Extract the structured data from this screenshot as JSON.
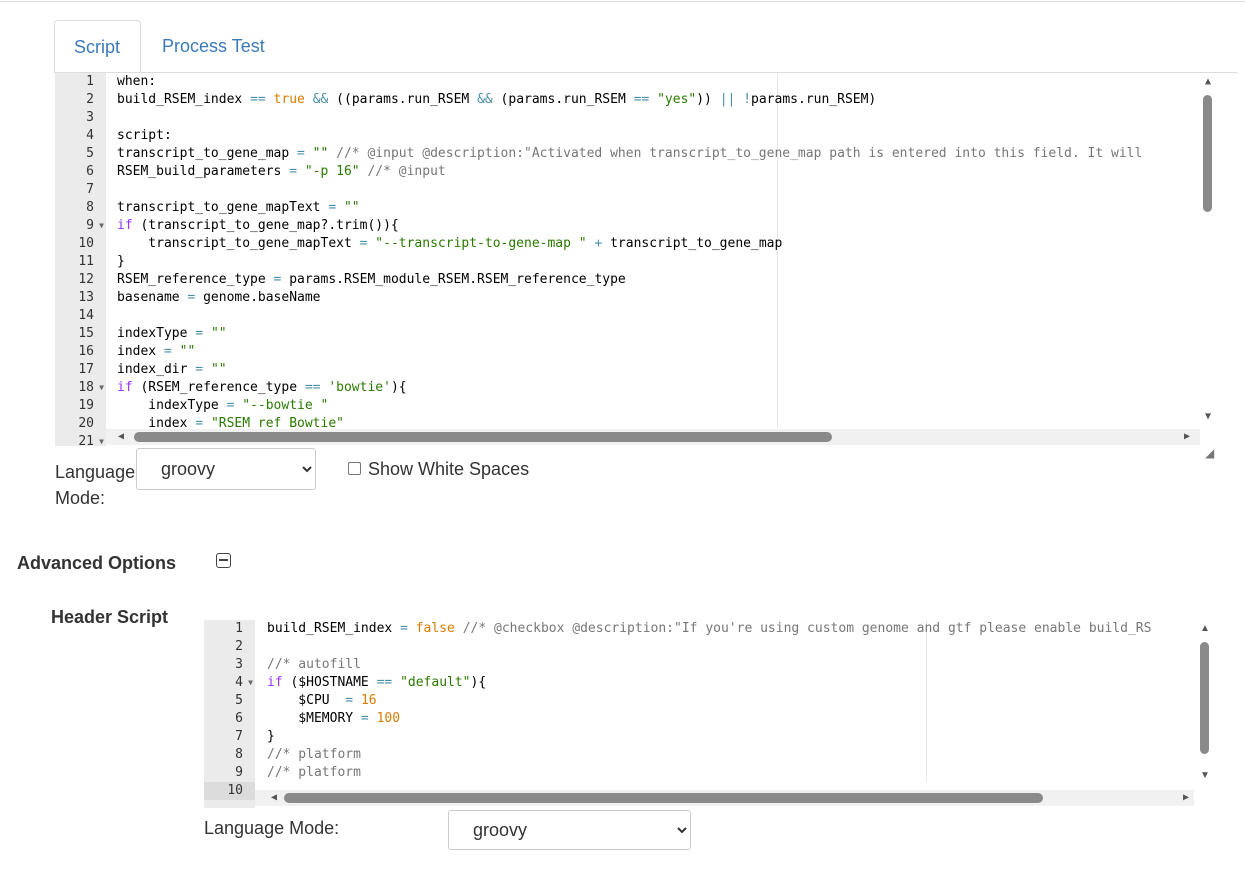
{
  "tabs": [
    {
      "label": "Script",
      "active": true
    },
    {
      "label": "Process Test",
      "active": false
    }
  ],
  "script_editor": {
    "lines": [
      {
        "n": "1",
        "fold": false,
        "code": [
          [
            "",
            "when:"
          ]
        ]
      },
      {
        "n": "2",
        "fold": false,
        "code": [
          [
            "",
            "build_RSEM_index "
          ],
          [
            "o",
            "=="
          ],
          [
            "",
            " "
          ],
          [
            "n",
            "true"
          ],
          [
            "",
            " "
          ],
          [
            "o",
            "&&"
          ],
          [
            "",
            " ((params.run_RSEM "
          ],
          [
            "o",
            "&&"
          ],
          [
            "",
            " (params.run_RSEM "
          ],
          [
            "o",
            "=="
          ],
          [
            "",
            " "
          ],
          [
            "s",
            "\"yes\""
          ],
          [
            "",
            "))"
          ],
          [
            "",
            " "
          ],
          [
            "o",
            "||"
          ],
          [
            "",
            " "
          ],
          [
            "o",
            "!"
          ],
          [
            "",
            "params.run_RSEM)"
          ]
        ]
      },
      {
        "n": "3",
        "fold": false,
        "code": []
      },
      {
        "n": "4",
        "fold": false,
        "code": [
          [
            "",
            "script:"
          ]
        ]
      },
      {
        "n": "5",
        "fold": false,
        "code": [
          [
            "",
            "transcript_to_gene_map "
          ],
          [
            "o",
            "="
          ],
          [
            "",
            " "
          ],
          [
            "s",
            "\"\""
          ],
          [
            "",
            " "
          ],
          [
            "c",
            "//* @input @description:\"Activated when transcript_to_gene_map path is entered into this field. It will"
          ]
        ]
      },
      {
        "n": "6",
        "fold": false,
        "code": [
          [
            "",
            "RSEM_build_parameters "
          ],
          [
            "o",
            "="
          ],
          [
            "",
            " "
          ],
          [
            "s",
            "\"-p 16\""
          ],
          [
            "",
            " "
          ],
          [
            "c",
            "//* @input"
          ]
        ]
      },
      {
        "n": "7",
        "fold": false,
        "code": []
      },
      {
        "n": "8",
        "fold": false,
        "code": [
          [
            "",
            "transcript_to_gene_mapText "
          ],
          [
            "o",
            "="
          ],
          [
            "",
            " "
          ],
          [
            "s",
            "\"\""
          ]
        ]
      },
      {
        "n": "9",
        "fold": true,
        "code": [
          [
            "k",
            "if"
          ],
          [
            "",
            " (transcript_to_gene_map?.trim()){"
          ]
        ]
      },
      {
        "n": "10",
        "fold": false,
        "code": [
          [
            "",
            "    transcript_to_gene_mapText "
          ],
          [
            "o",
            "="
          ],
          [
            "",
            " "
          ],
          [
            "s",
            "\"--transcript-to-gene-map \""
          ],
          [
            "",
            " "
          ],
          [
            "o",
            "+"
          ],
          [
            "",
            " transcript_to_gene_map"
          ]
        ]
      },
      {
        "n": "11",
        "fold": false,
        "code": [
          [
            "",
            "}"
          ]
        ]
      },
      {
        "n": "12",
        "fold": false,
        "code": [
          [
            "",
            "RSEM_reference_type "
          ],
          [
            "o",
            "="
          ],
          [
            "",
            " params.RSEM_module_RSEM.RSEM_reference_type"
          ]
        ]
      },
      {
        "n": "13",
        "fold": false,
        "code": [
          [
            "",
            "basename "
          ],
          [
            "o",
            "="
          ],
          [
            "",
            " genome.baseName"
          ]
        ]
      },
      {
        "n": "14",
        "fold": false,
        "code": []
      },
      {
        "n": "15",
        "fold": false,
        "code": [
          [
            "",
            "indexType "
          ],
          [
            "o",
            "="
          ],
          [
            "",
            " "
          ],
          [
            "s",
            "\"\""
          ]
        ]
      },
      {
        "n": "16",
        "fold": false,
        "code": [
          [
            "",
            "index "
          ],
          [
            "o",
            "="
          ],
          [
            "",
            " "
          ],
          [
            "s",
            "\"\""
          ]
        ]
      },
      {
        "n": "17",
        "fold": false,
        "code": [
          [
            "",
            "index_dir "
          ],
          [
            "o",
            "="
          ],
          [
            "",
            " "
          ],
          [
            "s",
            "\"\""
          ]
        ]
      },
      {
        "n": "18",
        "fold": true,
        "code": [
          [
            "k",
            "if"
          ],
          [
            "",
            " (RSEM_reference_type "
          ],
          [
            "o",
            "=="
          ],
          [
            "",
            " "
          ],
          [
            "s",
            "'bowtie'"
          ],
          [
            "",
            "){"
          ]
        ]
      },
      {
        "n": "19",
        "fold": false,
        "code": [
          [
            "",
            "    indexType "
          ],
          [
            "o",
            "="
          ],
          [
            "",
            " "
          ],
          [
            "s",
            "\"--bowtie \""
          ]
        ]
      },
      {
        "n": "20",
        "fold": false,
        "code": [
          [
            "",
            "    index "
          ],
          [
            "o",
            "="
          ],
          [
            "",
            " "
          ],
          [
            "s",
            "\"RSEM_ref_Bowtie\""
          ]
        ]
      },
      {
        "n": "21",
        "fold": true,
        "code": []
      }
    ]
  },
  "language_mode": {
    "label_line1": "Language",
    "label_line2": "Mode:",
    "value": "groovy",
    "show_white_spaces_label": "Show White Spaces"
  },
  "advanced": {
    "heading": "Advanced Options",
    "header_script_heading": "Header Script",
    "language_mode_label": "Language Mode:",
    "language_mode_value": "groovy"
  },
  "header_editor": {
    "lines": [
      {
        "n": "1",
        "fold": false,
        "code": [
          [
            "",
            "build_RSEM_index "
          ],
          [
            "o",
            "="
          ],
          [
            "",
            " "
          ],
          [
            "n",
            "false"
          ],
          [
            "",
            " "
          ],
          [
            "c",
            "//* @checkbox @description:\"If you're using custom genome and gtf please enable build_RS"
          ]
        ]
      },
      {
        "n": "2",
        "fold": false,
        "code": []
      },
      {
        "n": "3",
        "fold": false,
        "code": [
          [
            "c",
            "//* autofill"
          ]
        ]
      },
      {
        "n": "4",
        "fold": true,
        "code": [
          [
            "k",
            "if"
          ],
          [
            "",
            " ($HOSTNAME "
          ],
          [
            "o",
            "=="
          ],
          [
            "",
            " "
          ],
          [
            "s",
            "\"default\""
          ],
          [
            "",
            "){"
          ]
        ]
      },
      {
        "n": "5",
        "fold": false,
        "code": [
          [
            "",
            "    $CPU  "
          ],
          [
            "o",
            "="
          ],
          [
            "",
            " "
          ],
          [
            "n",
            "16"
          ]
        ]
      },
      {
        "n": "6",
        "fold": false,
        "code": [
          [
            "",
            "    $MEMORY "
          ],
          [
            "o",
            "="
          ],
          [
            "",
            " "
          ],
          [
            "n",
            "100"
          ]
        ]
      },
      {
        "n": "7",
        "fold": false,
        "code": [
          [
            "",
            "}"
          ]
        ]
      },
      {
        "n": "8",
        "fold": false,
        "code": [
          [
            "c",
            "//* platform"
          ]
        ]
      },
      {
        "n": "9",
        "fold": false,
        "code": [
          [
            "c",
            "//* platform"
          ]
        ]
      },
      {
        "n": "10",
        "fold": false,
        "code": []
      }
    ],
    "active_line": "10"
  }
}
